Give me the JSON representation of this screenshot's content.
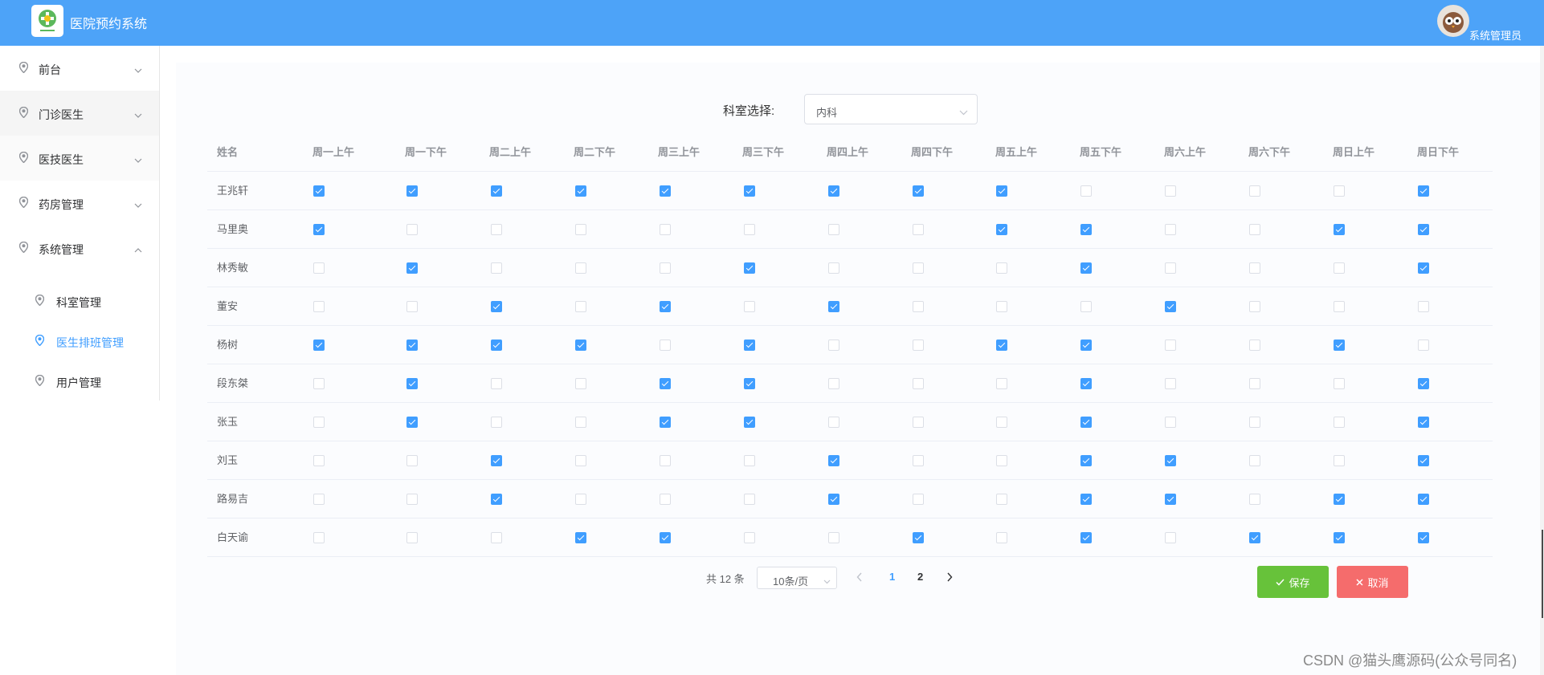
{
  "header": {
    "app_title": "医院预约系统",
    "user_name": "系统管理员",
    "accent": "#4da3f8"
  },
  "sidebar": {
    "items": [
      {
        "label": "前台",
        "icon": "location-icon",
        "expanded": false
      },
      {
        "label": "门诊医生",
        "icon": "location-icon",
        "expanded": false
      },
      {
        "label": "医技医生",
        "icon": "location-icon",
        "expanded": false
      },
      {
        "label": "药房管理",
        "icon": "location-icon",
        "expanded": false
      },
      {
        "label": "系统管理",
        "icon": "location-icon",
        "expanded": true
      }
    ],
    "sub_items": [
      {
        "label": "科室管理",
        "active": false
      },
      {
        "label": "医生排班管理",
        "active": true
      },
      {
        "label": "用户管理",
        "active": false
      }
    ]
  },
  "department": {
    "label": "科室选择:",
    "selected": "内科"
  },
  "table": {
    "headers": [
      "姓名",
      "周一上午",
      "周一下午",
      "周二上午",
      "周二下午",
      "周三上午",
      "周三下午",
      "周四上午",
      "周四下午",
      "周五上午",
      "周五下午",
      "周六上午",
      "周六下午",
      "周日上午",
      "周日下午"
    ],
    "rows": [
      {
        "name": "王兆轩",
        "slots": [
          1,
          1,
          1,
          1,
          1,
          1,
          1,
          1,
          1,
          0,
          0,
          0,
          0,
          1
        ]
      },
      {
        "name": "马里奥",
        "slots": [
          1,
          0,
          0,
          0,
          0,
          0,
          0,
          0,
          1,
          1,
          0,
          0,
          1,
          1
        ]
      },
      {
        "name": "林秀敏",
        "slots": [
          0,
          1,
          0,
          0,
          0,
          1,
          0,
          0,
          0,
          1,
          0,
          0,
          0,
          1
        ]
      },
      {
        "name": "董安",
        "slots": [
          0,
          0,
          1,
          0,
          1,
          0,
          1,
          0,
          0,
          0,
          1,
          0,
          0,
          0
        ]
      },
      {
        "name": "杨树",
        "slots": [
          1,
          1,
          1,
          1,
          0,
          1,
          0,
          0,
          1,
          1,
          0,
          0,
          1,
          0
        ]
      },
      {
        "name": "段东桀",
        "slots": [
          0,
          1,
          0,
          0,
          1,
          1,
          0,
          0,
          0,
          1,
          0,
          0,
          0,
          1
        ]
      },
      {
        "name": "张玉",
        "slots": [
          0,
          1,
          0,
          0,
          1,
          1,
          0,
          0,
          0,
          1,
          0,
          0,
          0,
          1
        ]
      },
      {
        "name": "刘玉",
        "slots": [
          0,
          0,
          1,
          0,
          0,
          0,
          1,
          0,
          0,
          1,
          1,
          0,
          0,
          1
        ]
      },
      {
        "name": "路易吉",
        "slots": [
          0,
          0,
          1,
          0,
          0,
          0,
          1,
          0,
          0,
          1,
          1,
          0,
          1,
          1
        ]
      },
      {
        "name": "白天谕",
        "slots": [
          0,
          0,
          0,
          1,
          1,
          0,
          0,
          1,
          0,
          1,
          0,
          1,
          1,
          1
        ]
      }
    ]
  },
  "pagination": {
    "total_text": "共 12 条",
    "page_size": "10条/页",
    "pages": [
      "1",
      "2"
    ],
    "current_page": "1"
  },
  "actions": {
    "save_label": "保存",
    "cancel_label": "取消"
  },
  "watermark": "CSDN @猫头鹰源码(公众号同名)",
  "colors": {
    "primary": "#409eff",
    "success": "#67c23a",
    "danger": "#f56c6c"
  }
}
